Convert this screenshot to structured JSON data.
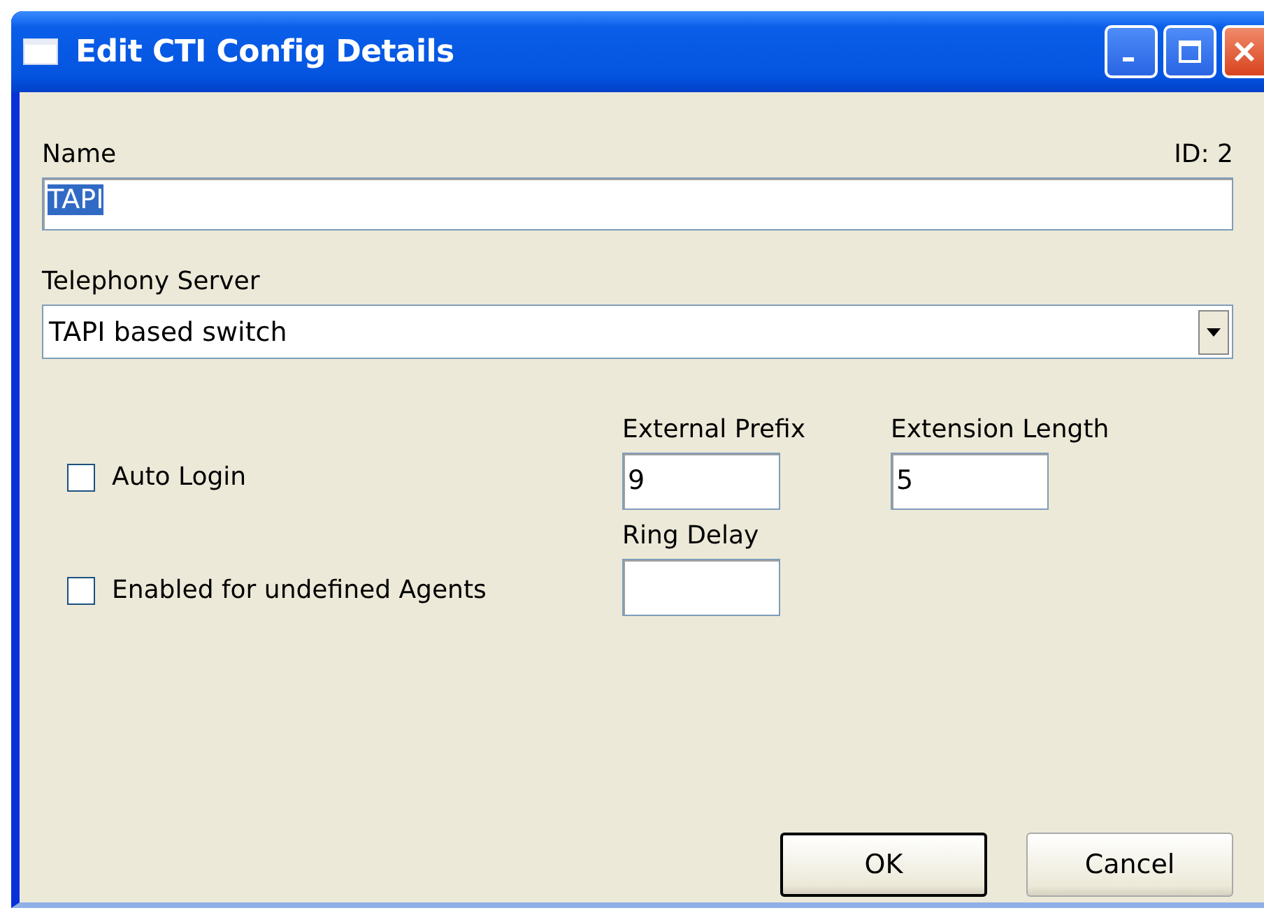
{
  "window": {
    "title": "Edit CTI Config Details"
  },
  "name_field": {
    "label": "Name",
    "value": "TAPI",
    "text_selected": true
  },
  "id_label": "ID: 2",
  "telephony_server": {
    "label": "Telephony Server",
    "value": "TAPI based switch"
  },
  "checkboxes": [
    {
      "label": "Auto Login",
      "checked": false
    },
    {
      "label": "Enabled for undefined Agents",
      "checked": false
    }
  ],
  "fields": [
    {
      "label": "External Prefix",
      "value": "9"
    },
    {
      "label": "Extension Length",
      "value": "5"
    },
    {
      "label": "Ring Delay"
    }
  ],
  "buttons": [
    {
      "label": "OK",
      "default": true
    },
    {
      "label": "Cancel",
      "default": false
    }
  ]
}
